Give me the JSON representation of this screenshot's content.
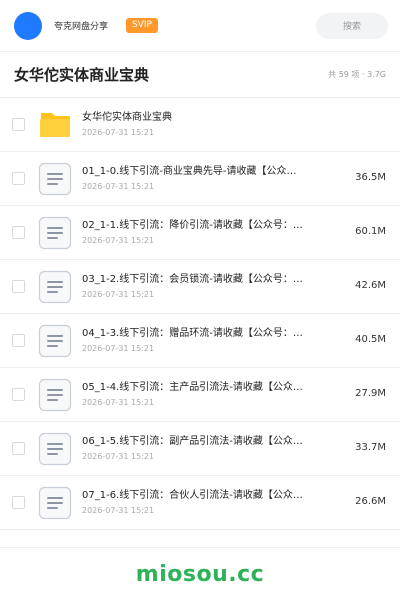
{
  "app": {
    "share_title": "夸克网盘分享",
    "badge": "SVIP",
    "search_label": "搜索"
  },
  "folder": {
    "title": "女华佗实体商业宝典",
    "meta": "共 59 项 · 3.7G"
  },
  "items": [
    {
      "name": "女华佗实体商业宝典",
      "date": "2026-07-31 15:21",
      "size": "",
      "icon": "folder-icon"
    },
    {
      "name": "01_1-0.线下引流-商业宝典先导-请收藏【公众…",
      "date": "2026-07-31 15:21",
      "size": "36.5M",
      "icon": "document-icon"
    },
    {
      "name": "02_1-1.线下引流：降价引流-请收藏【公众号：…",
      "date": "2026-07-31 15:21",
      "size": "60.1M",
      "icon": "document-icon"
    },
    {
      "name": "03_1-2.线下引流：会员锁流-请收藏【公众号：…",
      "date": "2026-07-31 15:21",
      "size": "42.6M",
      "icon": "document-icon"
    },
    {
      "name": "04_1-3.线下引流：赠品环流-请收藏【公众号：…",
      "date": "2026-07-31 15:21",
      "size": "40.5M",
      "icon": "document-icon"
    },
    {
      "name": "05_1-4.线下引流：主产品引流法-请收藏【公众…",
      "date": "2026-07-31 15:21",
      "size": "27.9M",
      "icon": "document-icon"
    },
    {
      "name": "06_1-5.线下引流：副产品引流法-请收藏【公众…",
      "date": "2026-07-31 15:21",
      "size": "33.7M",
      "icon": "document-icon"
    },
    {
      "name": "07_1-6.线下引流：合伙人引流法-请收藏【公众…",
      "date": "2026-07-31 15:21",
      "size": "26.6M",
      "icon": "document-icon"
    }
  ],
  "watermark": "miosou.cc",
  "colors": {
    "accent": "#1e7bff",
    "svip": "#ff9a2a",
    "folder": "#ffc21a",
    "watermark": "#2db25a"
  }
}
